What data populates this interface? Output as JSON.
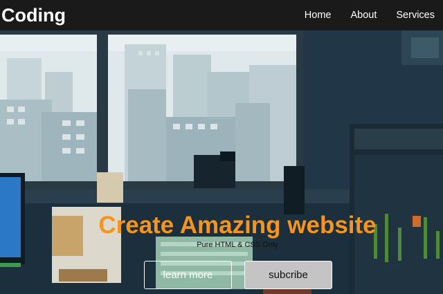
{
  "header": {
    "brand": "n Coding",
    "nav": [
      {
        "label": "Home"
      },
      {
        "label": "About"
      },
      {
        "label": "Services"
      }
    ]
  },
  "hero": {
    "title": "Create Amazing website",
    "subtitle": "Pure HTML & CSS Only",
    "buttons": {
      "primary_label": "learn more",
      "secondary_label": "subcribe"
    }
  },
  "colors": {
    "navbar_bg": "#1a1a1a",
    "accent": "#f7941d",
    "button_solid_bg": "#c4c4c4"
  }
}
